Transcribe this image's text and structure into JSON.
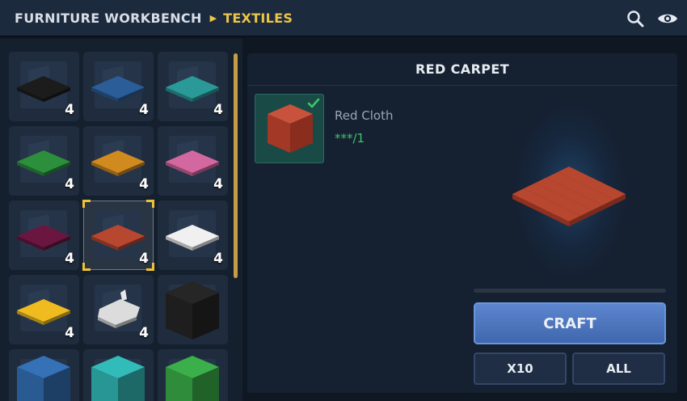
{
  "header": {
    "breadcrumb": [
      "FURNITURE WORKBENCH",
      "TEXTILES"
    ],
    "icons": [
      "search-icon",
      "eye-icon"
    ]
  },
  "inventory": {
    "slots": [
      {
        "item": "black-carpet",
        "color": "#1c1c1c",
        "kind": "carpet",
        "count": "4"
      },
      {
        "item": "blue-carpet",
        "color": "#2b5d98",
        "kind": "carpet",
        "count": "4"
      },
      {
        "item": "cyan-carpet",
        "color": "#2a9a98",
        "kind": "carpet",
        "count": "4"
      },
      {
        "item": "green-carpet",
        "color": "#2c8f3c",
        "kind": "carpet",
        "count": "4"
      },
      {
        "item": "orange-carpet",
        "color": "#d08a1e",
        "kind": "carpet",
        "count": "4"
      },
      {
        "item": "pink-carpet",
        "color": "#d3679f",
        "kind": "carpet",
        "count": "4"
      },
      {
        "item": "purple-carpet",
        "color": "#6a1640",
        "kind": "carpet",
        "count": "4"
      },
      {
        "item": "red-carpet",
        "color": "#b8472f",
        "kind": "carpet",
        "count": "4",
        "selected": true
      },
      {
        "item": "white-carpet",
        "color": "#f0f0f0",
        "kind": "carpet",
        "count": "4"
      },
      {
        "item": "yellow-carpet",
        "color": "#efbb1f",
        "kind": "carpet",
        "count": "4"
      },
      {
        "item": "fleece",
        "color": "#dcdcdc",
        "kind": "fleece",
        "count": "4"
      },
      {
        "item": "black-block",
        "color": "#1e1e1e",
        "kind": "block",
        "count": ""
      },
      {
        "item": "blue-block",
        "color": "#2a5a92",
        "kind": "block",
        "count": ""
      },
      {
        "item": "cyan-block",
        "color": "#289694",
        "kind": "block",
        "count": ""
      },
      {
        "item": "green-block",
        "color": "#2f8c3a",
        "kind": "block",
        "count": ""
      }
    ]
  },
  "detail": {
    "title": "RED CARPET",
    "ingredient": {
      "name": "Red Cloth",
      "quantity": "***/1",
      "color": "#b5402d",
      "icon": "check-icon"
    },
    "preview_color": "#b8472f",
    "buttons": {
      "craft": "CRAFT",
      "x10": "X10",
      "all": "ALL"
    }
  },
  "colors": {
    "accent": "#ecc548",
    "craft_button": "#4f78c0",
    "available": "#3ec56c"
  }
}
